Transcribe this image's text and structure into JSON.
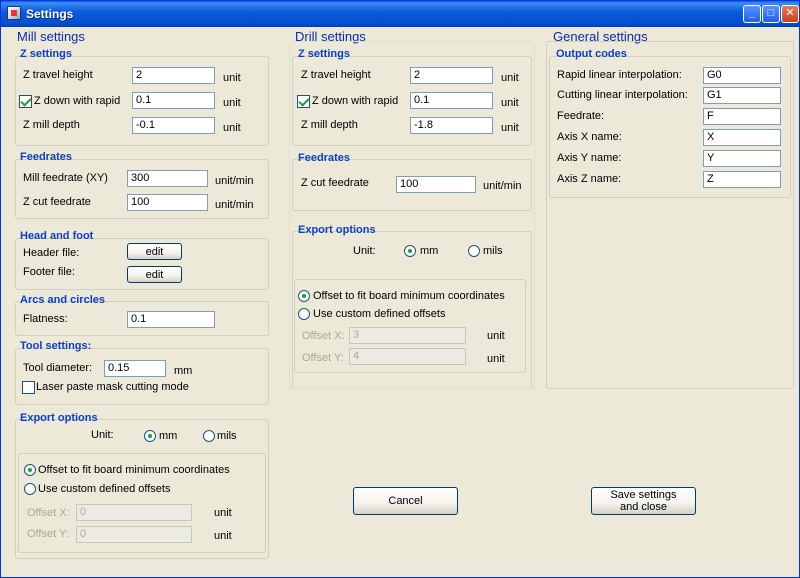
{
  "window": {
    "title": "Settings"
  },
  "titlebar_buttons": {
    "minimize": "_",
    "maximize": "□",
    "close": "✕"
  },
  "icons": {
    "app": "settings-app-icon"
  },
  "mill": {
    "title": "Mill settings",
    "z_settings": {
      "title": "Z settings",
      "z_travel_label": "Z travel height",
      "z_travel_value": "2",
      "z_down_label": "Z down with rapid",
      "z_down_checked": true,
      "z_down_value": "0.1",
      "z_depth_label": "Z mill depth",
      "z_depth_value": "-0.1",
      "unit": "unit"
    },
    "feedrates": {
      "title": "Feedrates",
      "mill_label": "Mill feedrate (XY)",
      "mill_value": "300",
      "zcut_label": "Z cut feedrate",
      "zcut_value": "100",
      "unit": "unit/min"
    },
    "head_foot": {
      "title": "Head and foot",
      "header_label": "Header file:",
      "footer_label": "Footer file:",
      "edit_label": "edit"
    },
    "arcs": {
      "title": "Arcs and circles",
      "flatness_label": "Flatness:",
      "flatness_value": "0.1"
    },
    "tool": {
      "title": "Tool settings:",
      "diameter_label": "Tool diameter:",
      "diameter_value": "0.15",
      "diameter_unit": "mm",
      "laser_label": "Laser paste mask cutting mode"
    },
    "export": {
      "title": "Export options",
      "unit_label": "Unit:",
      "mm_label": "mm",
      "mils_label": "mils",
      "offset_fit_label": "Offset to fit board minimum coordinates",
      "custom_label": "Use custom defined offsets",
      "offset_x_label": "Offset X:",
      "offset_x_value": "0",
      "offset_y_label": "Offset Y:",
      "offset_y_value": "0",
      "unit": "unit"
    }
  },
  "drill": {
    "title": "Drill settings",
    "z_settings": {
      "title": "Z settings",
      "z_travel_label": "Z travel height",
      "z_travel_value": "2",
      "z_down_label": "Z down with rapid",
      "z_down_checked": true,
      "z_down_value": "0.1",
      "z_depth_label": "Z mill depth",
      "z_depth_value": "-1.8",
      "unit": "unit"
    },
    "feedrates": {
      "title": "Feedrates",
      "zcut_label": "Z cut feedrate",
      "zcut_value": "100",
      "unit": "unit/min"
    },
    "export": {
      "title": "Export options",
      "unit_label": "Unit:",
      "mm_label": "mm",
      "mils_label": "mils",
      "offset_fit_label": "Offset to fit board minimum coordinates",
      "custom_label": "Use custom defined offsets",
      "offset_x_label": "Offset X:",
      "offset_x_value": "3",
      "offset_y_label": "Offset Y:",
      "offset_y_value": "4",
      "unit": "unit"
    }
  },
  "general": {
    "title": "General settings",
    "output_codes": {
      "title": "Output codes",
      "rapid_label": "Rapid linear interpolation:",
      "rapid_value": "G0",
      "cutting_label": "Cutting linear interpolation:",
      "cutting_value": "G1",
      "feedrate_label": "Feedrate:",
      "feedrate_value": "F",
      "axis_x_label": "Axis X name:",
      "axis_x_value": "X",
      "axis_y_label": "Axis Y name:",
      "axis_y_value": "Y",
      "axis_z_label": "Axis Z name:",
      "axis_z_value": "Z"
    }
  },
  "buttons": {
    "cancel": "Cancel",
    "save_line1": "Save settings",
    "save_line2": "and close"
  }
}
